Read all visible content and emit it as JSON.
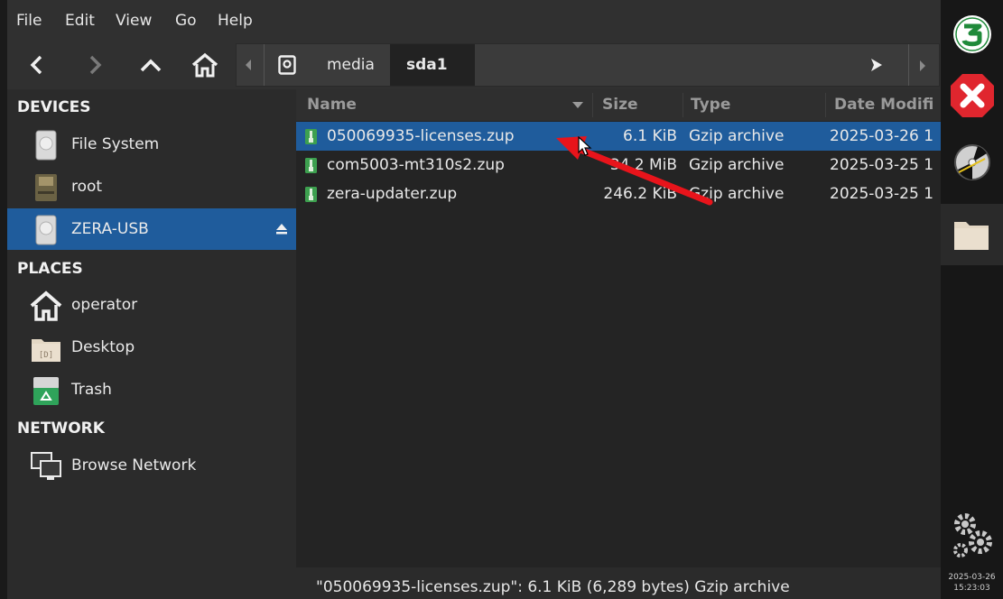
{
  "menu": [
    "File",
    "Edit",
    "View",
    "Go",
    "Help"
  ],
  "toolbar": {
    "back_icon": "chevron-left-icon",
    "forward_icon": "chevron-right-icon",
    "up_icon": "chevron-up-icon",
    "home_icon": "home-icon",
    "path": [
      "media",
      "sda1"
    ]
  },
  "sidebar": {
    "devices_header": "DEVICES",
    "devices": [
      "File System",
      "root",
      "ZERA-USB"
    ],
    "places_header": "PLACES",
    "places": [
      "operator",
      "Desktop",
      "Trash"
    ],
    "network_header": "NETWORK",
    "network": [
      "Browse Network"
    ]
  },
  "columns": {
    "name": "Name",
    "size": "Size",
    "type": "Type",
    "date": "Date Modifi"
  },
  "files": [
    {
      "name": "050069935-licenses.zup",
      "size": "6.1 KiB",
      "type": "Gzip archive",
      "date": "2025-03-26 1"
    },
    {
      "name": "com5003-mt310s2.zup",
      "size": "34.2 MiB",
      "type": "Gzip archive",
      "date": "2025-03-25 1"
    },
    {
      "name": "zera-updater.zup",
      "size": "246.2 KiB",
      "type": "Gzip archive",
      "date": "2025-03-25 1"
    }
  ],
  "status": "\"050069935-licenses.zup\": 6.1 KiB (6,289 bytes) Gzip archive",
  "clock": {
    "date": "2025-03-26",
    "time": "15:23:03"
  },
  "colors": {
    "selection": "#1f5c9c",
    "annotation_arrow": "#e8141b"
  }
}
